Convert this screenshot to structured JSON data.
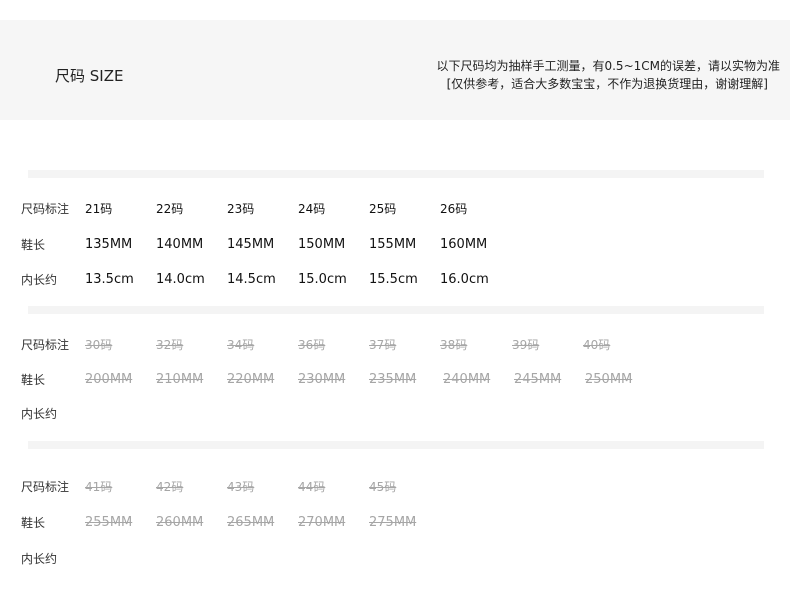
{
  "header": {
    "title": "尺码 SIZE",
    "note_line1": "以下尺码均为抽样手工测量，有0.5~1CM的误差，请以实物为准",
    "note_line2": "[仅供参考，适合大多数宝宝，不作为退换货理由，谢谢理解]"
  },
  "tables": [
    {
      "rows": [
        {
          "label": "尺码标注",
          "values": [
            "21码",
            "22码",
            "23码",
            "24码",
            "25码",
            "26码"
          ]
        },
        {
          "label": "鞋长",
          "values": [
            "135MM",
            "140MM",
            "145MM",
            "150MM",
            "155MM",
            "160MM"
          ]
        },
        {
          "label": "内长约",
          "values": [
            "13.5cm",
            "14.0cm",
            "14.5cm",
            "15.0cm",
            "15.5cm",
            "16.0cm"
          ]
        }
      ]
    },
    {
      "rows": [
        {
          "label": "尺码标注",
          "values": [
            "30码",
            "32码",
            "34码",
            "36码",
            "37码",
            "38码",
            "39码",
            "40码"
          ]
        },
        {
          "label": "鞋长",
          "values": [
            "200MM",
            "210MM",
            "220MM",
            "230MM",
            "235MM",
            "240MM",
            "245MM",
            "250MM"
          ]
        },
        {
          "label": "内长约",
          "values": []
        }
      ]
    },
    {
      "rows": [
        {
          "label": "尺码标注",
          "values": [
            "41码",
            "42码",
            "43码",
            "44码",
            "45码"
          ]
        },
        {
          "label": "鞋长",
          "values": [
            "255MM",
            "260MM",
            "265MM",
            "270MM",
            "275MM"
          ]
        },
        {
          "label": "内长约",
          "values": []
        }
      ]
    }
  ]
}
